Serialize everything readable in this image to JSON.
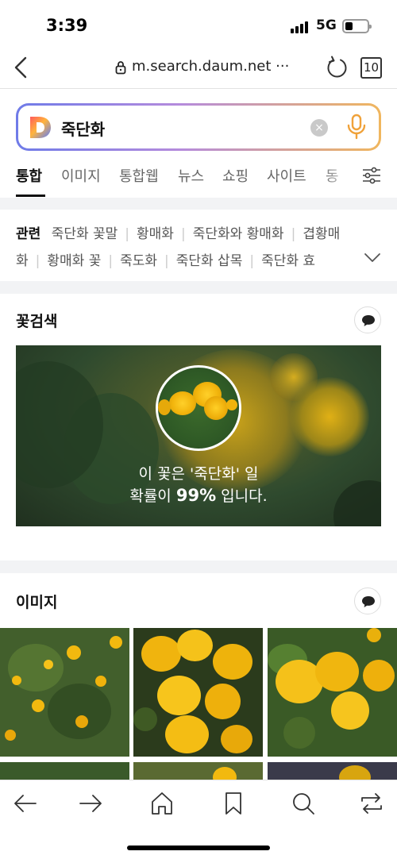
{
  "status": {
    "time": "3:39",
    "network": "5G"
  },
  "browser": {
    "url": "m.search.daum.net",
    "url_more": "···",
    "tab_count": "10"
  },
  "search": {
    "query": "죽단화",
    "clear": "×"
  },
  "tabs": [
    "통합",
    "이미지",
    "통합웹",
    "뉴스",
    "쇼핑",
    "사이트",
    "동"
  ],
  "related": {
    "label": "관련",
    "line1": [
      "죽단화 꽃말",
      "황매화",
      "죽단화와 황매화",
      "겹황매"
    ],
    "line2": [
      "화",
      "황매화 꽃",
      "죽도화",
      "죽단화 삽목",
      "죽단화 효"
    ]
  },
  "flower_search": {
    "title": "꽃검색",
    "result_line1": "이 꽃은 '죽단화' 일",
    "result_prefix": "확률이",
    "probability": "99%",
    "result_suffix": "입니다."
  },
  "images": {
    "title": "이미지"
  },
  "icons": [
    "back-icon",
    "lock-icon",
    "reload-icon",
    "mic-icon",
    "filter-icon",
    "chevron-down-icon",
    "chat-bubble-icon",
    "arrow-left-icon",
    "arrow-right-icon",
    "home-icon",
    "bookmark-icon",
    "search-icon",
    "share-icon"
  ],
  "colors": {
    "accent_blue": "#6f7be8",
    "accent_purple": "#b58bdc",
    "accent_orange": "#f0b65e",
    "flower_yellow": "#f2b90f"
  }
}
